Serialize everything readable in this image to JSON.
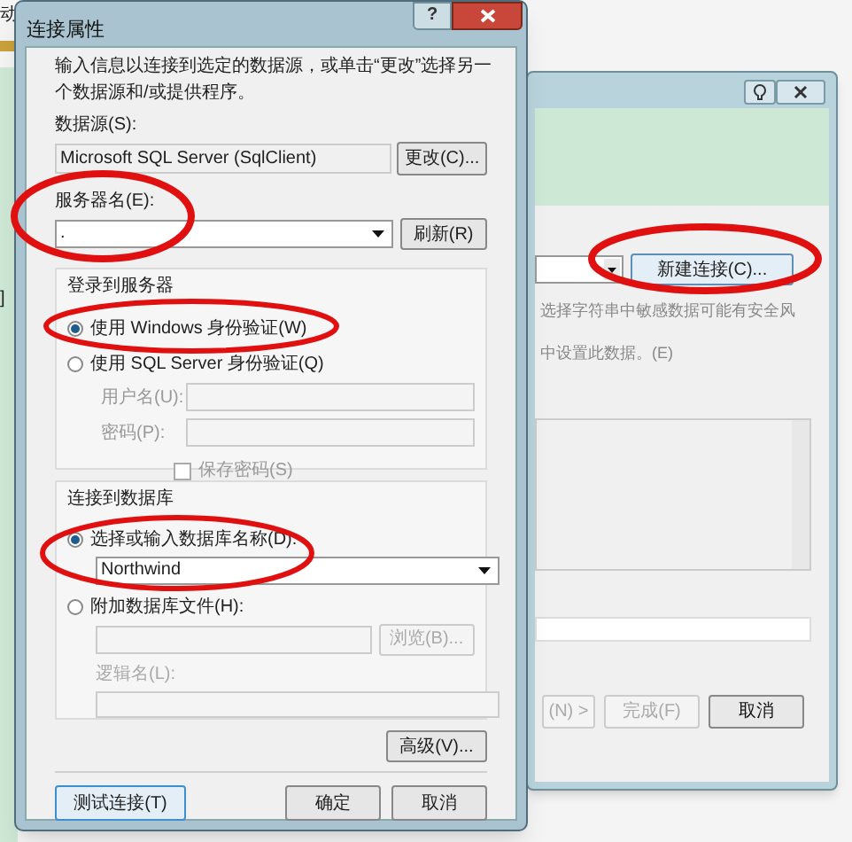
{
  "desktop": {
    "left_texts": [
      "动",
      "]"
    ]
  },
  "background_window": {
    "new_connection_button": "新建连接(C)...",
    "notes": [
      "选择字符串中敏感数据可能有安全风",
      "中设置此数据。(E)"
    ],
    "buttons": [
      {
        "label": "(N) >",
        "disabled": true
      },
      {
        "label": "完成(F)",
        "disabled": true
      },
      {
        "label": "取消",
        "disabled": false
      }
    ]
  },
  "dialog": {
    "title": "连接属性",
    "help_button": "?",
    "intro": "输入信息以连接到选定的数据源，或单击“更改”选择另一个数据源和/或提供程序。",
    "data_source": {
      "label": "数据源(S):",
      "value": "Microsoft SQL Server (SqlClient)",
      "button": "更改(C)..."
    },
    "server": {
      "label": "服务器名(E):",
      "value": ".",
      "button": "刷新(R)"
    },
    "login_group": {
      "title": "登录到服务器",
      "options": [
        {
          "label": "使用 Windows 身份验证(W)",
          "selected": true
        },
        {
          "label": "使用 SQL Server 身份验证(Q)",
          "selected": false
        }
      ],
      "username_label": "用户名(U):",
      "password_label": "密码(P):",
      "save_password": {
        "label": "保存密码(S)",
        "checked": false
      }
    },
    "database_group": {
      "title": "连接到数据库",
      "options": [
        {
          "label": "选择或输入数据库名称(D):",
          "selected": true
        },
        {
          "label": "附加数据库文件(H):",
          "selected": false
        }
      ],
      "database_name": "Northwind",
      "browse_button": "浏览(B)...",
      "logical_name_label": "逻辑名(L):"
    },
    "advanced_button": "高级(V)...",
    "test_button": "测试连接(T)",
    "ok_button": "确定",
    "cancel_button": "取消"
  }
}
